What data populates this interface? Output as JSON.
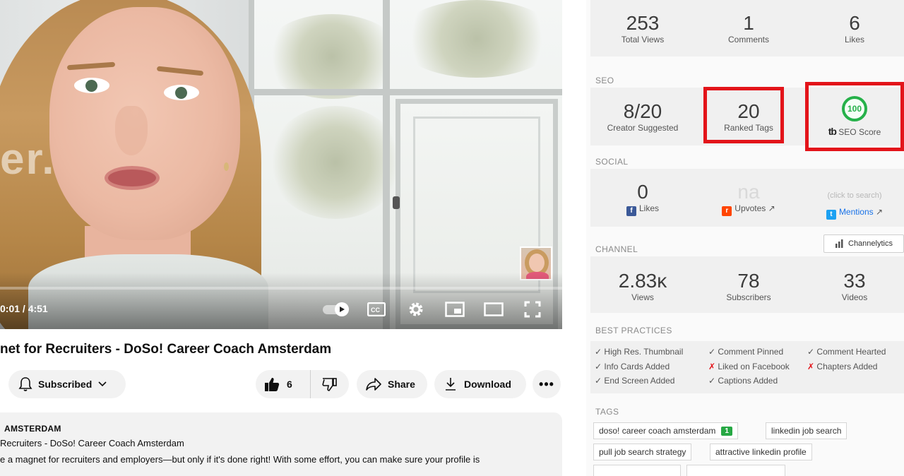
{
  "player": {
    "time": "0:01 / 4:51",
    "watermark": "er.",
    "progress_fraction": 0.003
  },
  "video": {
    "title": "net for Recruiters - DoSo! Career Coach Amsterdam",
    "subscribed_label": "Subscribed",
    "like_count": "6",
    "share_label": "Share",
    "download_label": "Download",
    "more_label": "•••"
  },
  "description": {
    "line1": "AMSTERDAM",
    "line2": "Recruiters - DoSo! Career Coach Amsterdam",
    "line3": "e a magnet for recruiters and employers—but only if it's done right! With some effort, you can make sure your profile is"
  },
  "stats": {
    "views": {
      "value": "253",
      "label": "Total Views"
    },
    "comments": {
      "value": "1",
      "label": "Comments"
    },
    "likes": {
      "value": "6",
      "label": "Likes"
    }
  },
  "seo": {
    "section": "SEO",
    "creator": {
      "value": "8/20",
      "label": "Creator Suggested"
    },
    "ranked": {
      "value": "20",
      "label": "Ranked Tags"
    },
    "score": {
      "value": "100",
      "label": "SEO Score",
      "logo": "tb"
    },
    "highlight_color": "#e3141a",
    "score_color": "#26b14a"
  },
  "social": {
    "section": "SOCIAL",
    "fb": {
      "value": "0",
      "label": "Likes"
    },
    "reddit": {
      "value": "na",
      "label": "Upvotes"
    },
    "twitter": {
      "hint": "(click to search)",
      "label": "Mentions"
    }
  },
  "channel": {
    "section": "CHANNEL",
    "button": "Channelytics",
    "views": {
      "value": "2.83ᴋ",
      "label": "Views"
    },
    "subscribers": {
      "value": "78",
      "label": "Subscribers"
    },
    "videos": {
      "value": "33",
      "label": "Videos"
    }
  },
  "best_practices": {
    "section": "BEST PRACTICES",
    "items": [
      {
        "mark": "✓",
        "text": "High Res. Thumbnail",
        "ok": true
      },
      {
        "mark": "✓",
        "text": "Comment Pinned",
        "ok": true
      },
      {
        "mark": "✓",
        "text": "Comment Hearted",
        "ok": true
      },
      {
        "mark": "✓",
        "text": "Info Cards Added",
        "ok": true
      },
      {
        "mark": "✗",
        "text": "Liked on Facebook",
        "ok": false
      },
      {
        "mark": "✗",
        "text": "Chapters Added",
        "ok": false
      },
      {
        "mark": "✓",
        "text": "End Screen Added",
        "ok": true
      },
      {
        "mark": "✓",
        "text": "Captions Added",
        "ok": true
      }
    ]
  },
  "tags": {
    "section": "TAGS",
    "items": [
      {
        "text": "doso! career coach amsterdam",
        "badge": "1"
      },
      {
        "text": "linkedin job search",
        "badge": ""
      },
      {
        "text": "pull job search strategy",
        "badge": ""
      },
      {
        "text": "attractive linkedin profile",
        "badge": ""
      }
    ]
  }
}
